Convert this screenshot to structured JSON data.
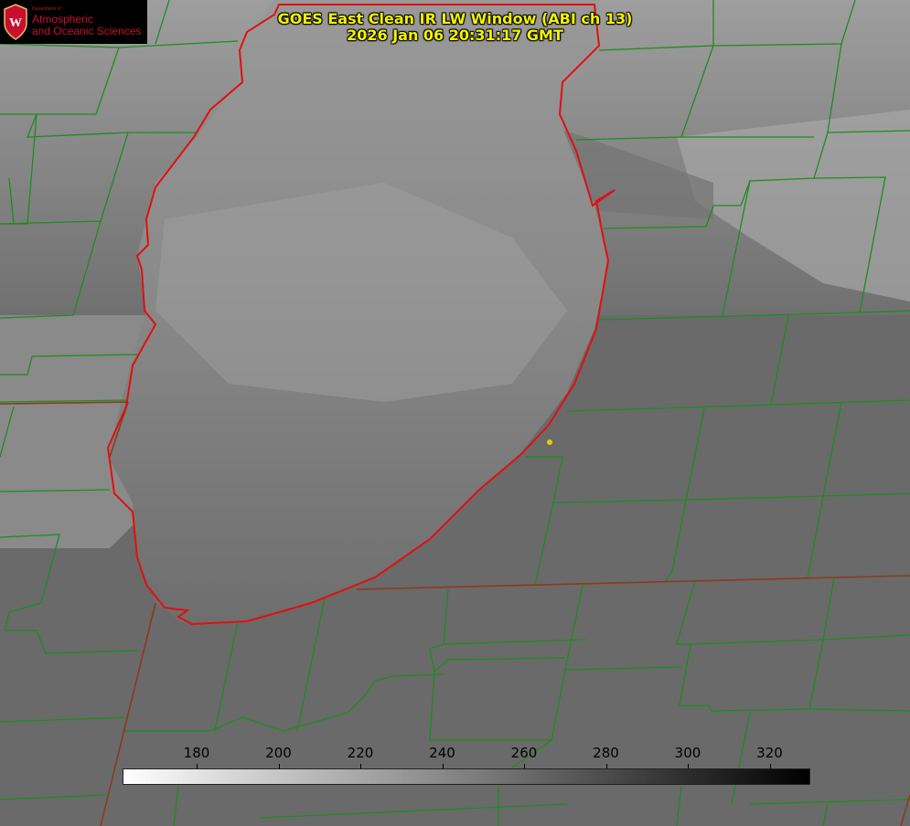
{
  "title": {
    "line1": "GOES East Clean IR LW Window (ABI ch 13)",
    "line2": "2026 Jan 06 20:31:17 GMT"
  },
  "logo": {
    "department": "Department of",
    "line1": "Atmospheric",
    "line2": "and Oceanic Sciences",
    "seal_letter": "W",
    "color": "#c8102e"
  },
  "colorbar": {
    "ticks": [
      "180",
      "200",
      "220",
      "240",
      "260",
      "280",
      "300",
      "320"
    ],
    "gradient": [
      "#ffffff",
      "#000000"
    ]
  },
  "colors": {
    "title": "#f2f200",
    "county_lines": "#1f8c1f",
    "state_lines": "#8b3a1a",
    "shoreline": "#e01010",
    "marker": "#e0d000"
  }
}
